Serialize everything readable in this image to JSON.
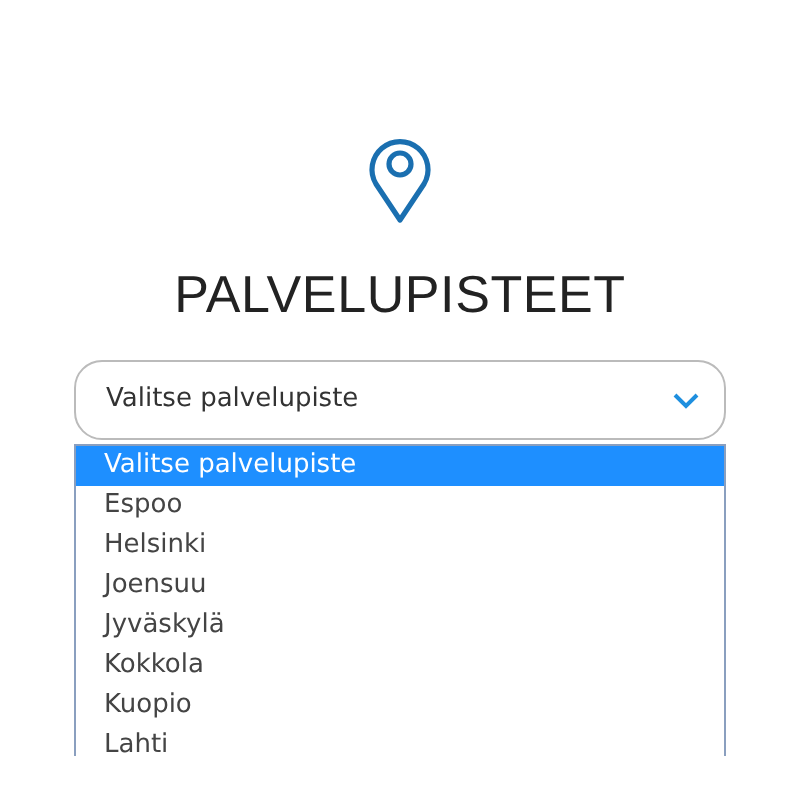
{
  "title": "PALVELUPISTEET",
  "select": {
    "value": "Valitse palvelupiste",
    "expanded": true
  },
  "options": [
    {
      "label": "Valitse palvelupiste",
      "selected": true
    },
    {
      "label": "Espoo",
      "selected": false
    },
    {
      "label": "Helsinki",
      "selected": false
    },
    {
      "label": "Joensuu",
      "selected": false
    },
    {
      "label": "Jyväskylä",
      "selected": false
    },
    {
      "label": "Kokkola",
      "selected": false
    },
    {
      "label": "Kuopio",
      "selected": false
    },
    {
      "label": "Lahti",
      "selected": false
    }
  ]
}
